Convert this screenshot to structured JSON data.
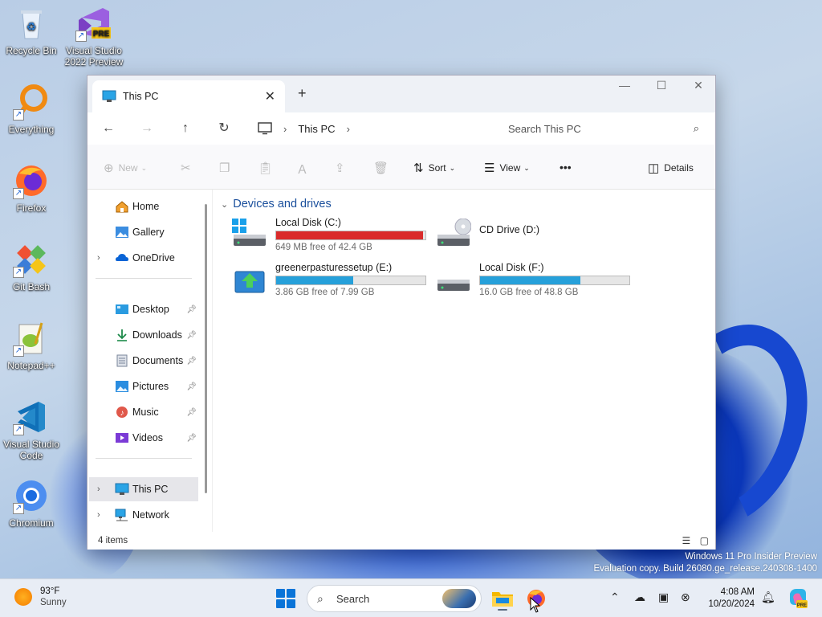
{
  "desktop": {
    "icons": [
      {
        "label": "Recycle Bin",
        "icon": "recycle-bin-icon"
      },
      {
        "label": "Visual Studio 2022 Preview",
        "icon": "visual-studio-icon",
        "badge": "PRE"
      },
      {
        "label": "Everything",
        "icon": "everything-search-icon"
      },
      {
        "label": "Firefox",
        "icon": "firefox-icon"
      },
      {
        "label": "Git Bash",
        "icon": "git-bash-icon"
      },
      {
        "label": "Notepad++",
        "icon": "notepad-plus-plus-icon"
      },
      {
        "label": "Visual Studio Code",
        "icon": "vscode-icon"
      },
      {
        "label": "Chromium",
        "icon": "chromium-icon"
      }
    ]
  },
  "window": {
    "tab_title": "This PC",
    "new_tab": "+",
    "breadcrumb": [
      "This PC"
    ],
    "search_placeholder": "Search This PC",
    "toolbar": {
      "new_label": "New",
      "sort_label": "Sort",
      "view_label": "View",
      "more_label": "•••",
      "details_label": "Details"
    },
    "sidebar": {
      "top": [
        "Home",
        "Gallery",
        "OneDrive"
      ],
      "quick": [
        "Desktop",
        "Downloads",
        "Documents",
        "Pictures",
        "Music",
        "Videos"
      ],
      "bottom": [
        "This PC",
        "Network"
      ]
    },
    "section_title": "Devices and drives",
    "drives": [
      {
        "name": "Local Disk (C:)",
        "free_text": "649 MB free of 42.4 GB",
        "used_fraction": 0.985,
        "bar_color": "#da2b2b",
        "icon": "windows-drive-icon"
      },
      {
        "name": "CD Drive (D:)",
        "free_text": "",
        "used_fraction": null,
        "bar_color": "",
        "icon": "cd-drive-icon"
      },
      {
        "name": "greenerpasturessetup (E:)",
        "free_text": "3.86 GB free of 7.99 GB",
        "used_fraction": 0.517,
        "bar_color": "#26a0da",
        "icon": "setup-drive-icon"
      },
      {
        "name": "Local Disk (F:)",
        "free_text": "16.0 GB free of 48.8 GB",
        "used_fraction": 0.672,
        "bar_color": "#26a0da",
        "icon": "hard-drive-icon"
      }
    ],
    "status": "4 items"
  },
  "watermark": {
    "line1": "Windows 11 Pro Insider Preview",
    "line2": "Evaluation copy. Build 26080.ge_release.240308-1400"
  },
  "taskbar": {
    "weather_temp": "93°F",
    "weather_desc": "Sunny",
    "search_label": "Search",
    "time": "4:08 AM",
    "date": "10/20/2024"
  }
}
